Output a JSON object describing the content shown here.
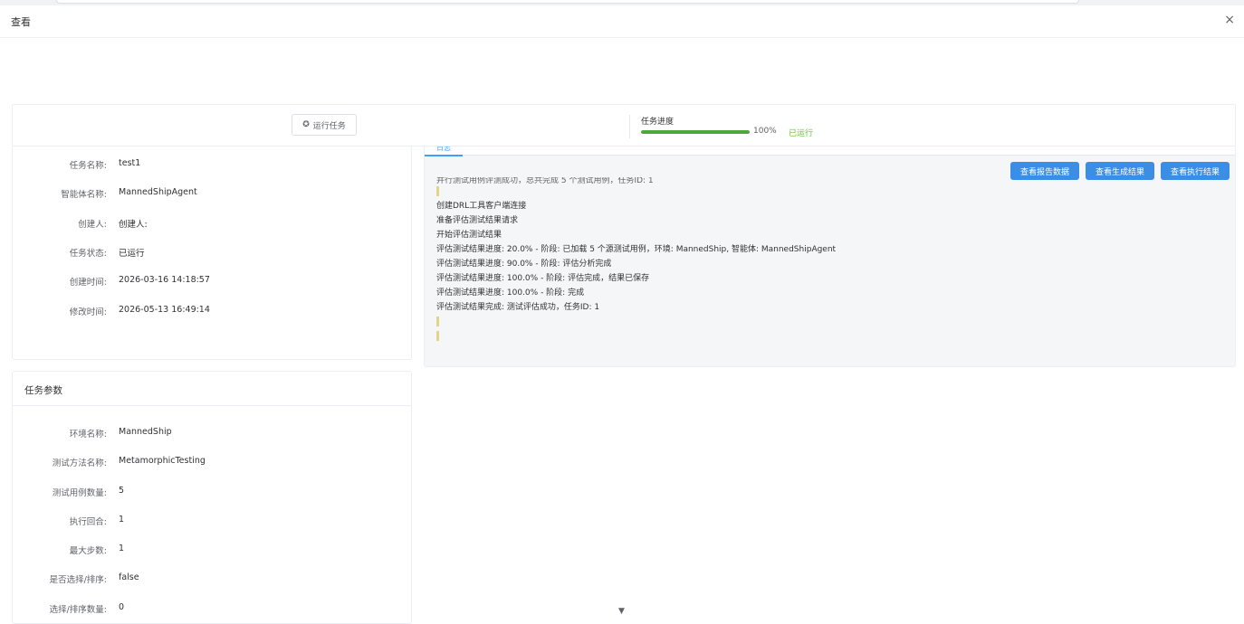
{
  "dialog": {
    "title": "查看",
    "close_glyph": "×"
  },
  "run_panel": {
    "run_button": "运行任务",
    "progress_label": "任务进度",
    "progress_value": 100,
    "progress_text": "100%",
    "status_text": "已运行"
  },
  "task_info": [
    {
      "label": "任务名称:",
      "value": "test1"
    },
    {
      "label": "智能体名称:",
      "value": "MannedShipAgent"
    },
    {
      "label": "创建人:",
      "value": "创建人:"
    },
    {
      "label": "任务状态:",
      "value": "已运行"
    },
    {
      "label": "创建时间:",
      "value": "2026-03-16 14:18:57"
    },
    {
      "label": "修改时间:",
      "value": "2026-05-13 16:49:14"
    }
  ],
  "params": {
    "title": "任务参数",
    "rows": [
      {
        "label": "环境名称:",
        "value": "MannedShip"
      },
      {
        "label": "测试方法名称:",
        "value": "MetamorphicTesting"
      },
      {
        "label": "测试用例数量:",
        "value": "5"
      },
      {
        "label": "执行回合:",
        "value": "1"
      },
      {
        "label": "最大步数:",
        "value": "1"
      },
      {
        "label": "是否选择/排序:",
        "value": "false"
      },
      {
        "label": "选择/排序数量:",
        "value": "0"
      }
    ]
  },
  "log_panel": {
    "tab_label": "日志",
    "buttons": [
      "查看报告数据",
      "查看生成结果",
      "查看执行结果"
    ],
    "truncated_line": "并行测试用例评测成功，总共完成 5 个测试用例，任务ID: 1",
    "lines": [
      "创建DRL工具客户端连接",
      "准备评估测试结果请求",
      "开始评估测试结果",
      "评估测试结果进度: 20.0% - 阶段: 已加载 5 个源测试用例，环境: MannedShip, 智能体: MannedShipAgent",
      "评估测试结果进度: 90.0% - 阶段: 评估分析完成",
      "评估测试结果进度: 100.0% - 阶段: 评估完成，结果已保存",
      "评估测试结果进度: 100.0% - 阶段: 完成",
      "评估测试结果完成: 测试评估成功，任务ID: 1"
    ]
  },
  "colors": {
    "primary": "#409eff",
    "success": "#67c23a",
    "progress": "#4ca83a",
    "log_marker": "#e6d38a"
  },
  "icons": {
    "close": "close-icon",
    "run": "gear-icon",
    "scroll": "chevron-down-icon"
  }
}
